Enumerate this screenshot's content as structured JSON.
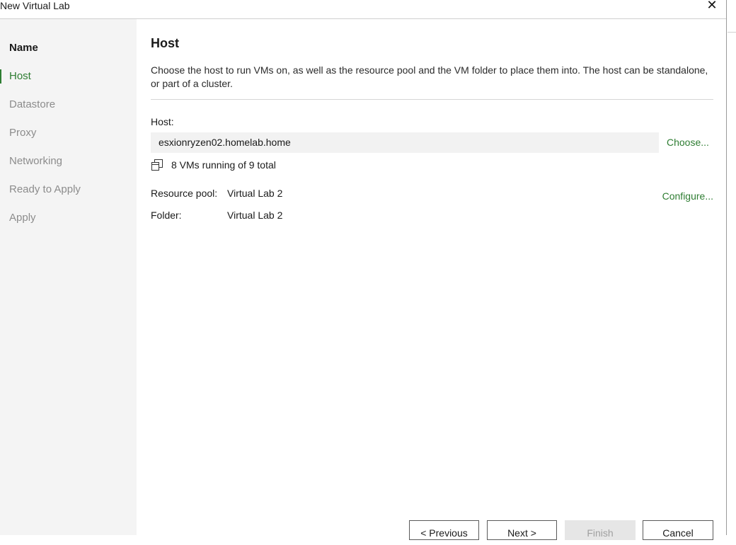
{
  "window": {
    "title": "New Virtual Lab",
    "close_icon": "close-icon"
  },
  "steps": [
    {
      "label": "Name",
      "state": "done"
    },
    {
      "label": "Host",
      "state": "active"
    },
    {
      "label": "Datastore",
      "state": "pending"
    },
    {
      "label": "Proxy",
      "state": "pending"
    },
    {
      "label": "Networking",
      "state": "pending"
    },
    {
      "label": "Ready to Apply",
      "state": "pending"
    },
    {
      "label": "Apply",
      "state": "pending"
    }
  ],
  "page": {
    "title": "Host",
    "description": "Choose the host to run VMs on, as well as the resource pool and the VM folder to place them into. The host can be standalone, or part of a cluster."
  },
  "host": {
    "label": "Host:",
    "value": "esxionryzen02.homelab.home",
    "choose_label": "Choose...",
    "vm_status": "8 VMs running of 9 total",
    "vm_icon": "vm-stack-icon"
  },
  "properties": {
    "resource_pool_label": "Resource pool:",
    "resource_pool_value": "Virtual Lab 2",
    "folder_label": "Folder:",
    "folder_value": "Virtual Lab 2",
    "configure_label": "Configure..."
  },
  "buttons": {
    "previous": "< Previous",
    "next": "Next >",
    "finish": "Finish",
    "cancel": "Cancel"
  },
  "colors": {
    "accent": "#2e7d32",
    "sidebar_bg": "#f4f4f4",
    "field_bg": "#f2f2f2",
    "disabled_bg": "#e6e6e6"
  }
}
